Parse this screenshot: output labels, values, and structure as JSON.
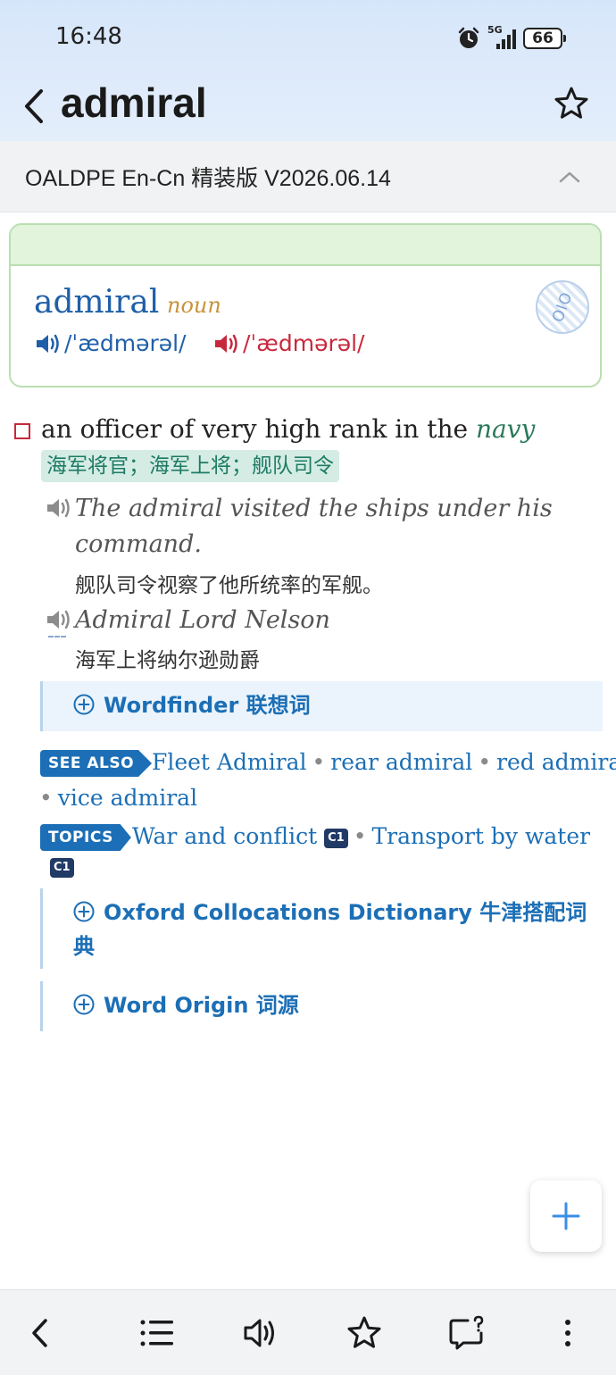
{
  "status": {
    "time": "16:48",
    "network": "5G",
    "battery": "66"
  },
  "header": {
    "title": "admiral"
  },
  "dictionary": {
    "name": "OALDPE En-Cn 精装版 V2026.06.14"
  },
  "entry": {
    "headword": "admiral",
    "pos": "noun",
    "pron_br": "/ˈædmərəl/",
    "pron_am": "/ˈædmərəl/",
    "level_mark": "OIO"
  },
  "sense": {
    "definition_prefix": "an officer of very high rank in the",
    "definition_link": "navy",
    "translation": "海军将官；海军上将；舰队司令",
    "examples": [
      {
        "en_line1": "The admiral visited the ships under his",
        "en_line2": "command.",
        "cn": "舰队司令视察了他所统率的军舰。"
      },
      {
        "en_line1": "Admiral Lord Nelson",
        "cn": "海军上将纳尔逊勋爵"
      }
    ]
  },
  "sections": {
    "wordfinder": "Wordfinder 联想词",
    "collocations_line1": "Oxford Collocations Dictionary 牛津搭配词",
    "collocations_line2": "典",
    "origin": "Word Origin 词源"
  },
  "see_also": {
    "label": "SEE ALSO",
    "items": [
      "Fleet Admiral",
      "rear admiral",
      "red admiral",
      "vice admiral"
    ]
  },
  "topics": {
    "label": "TOPICS",
    "items": [
      {
        "name": "War and conflict",
        "level": "C1"
      },
      {
        "name": "Transport by water",
        "level": "C1"
      }
    ]
  },
  "colors": {
    "accent": "#1c6fb6",
    "british": "#1f5fa8",
    "american": "#c8283c",
    "card_border": "#b9dfb1"
  }
}
